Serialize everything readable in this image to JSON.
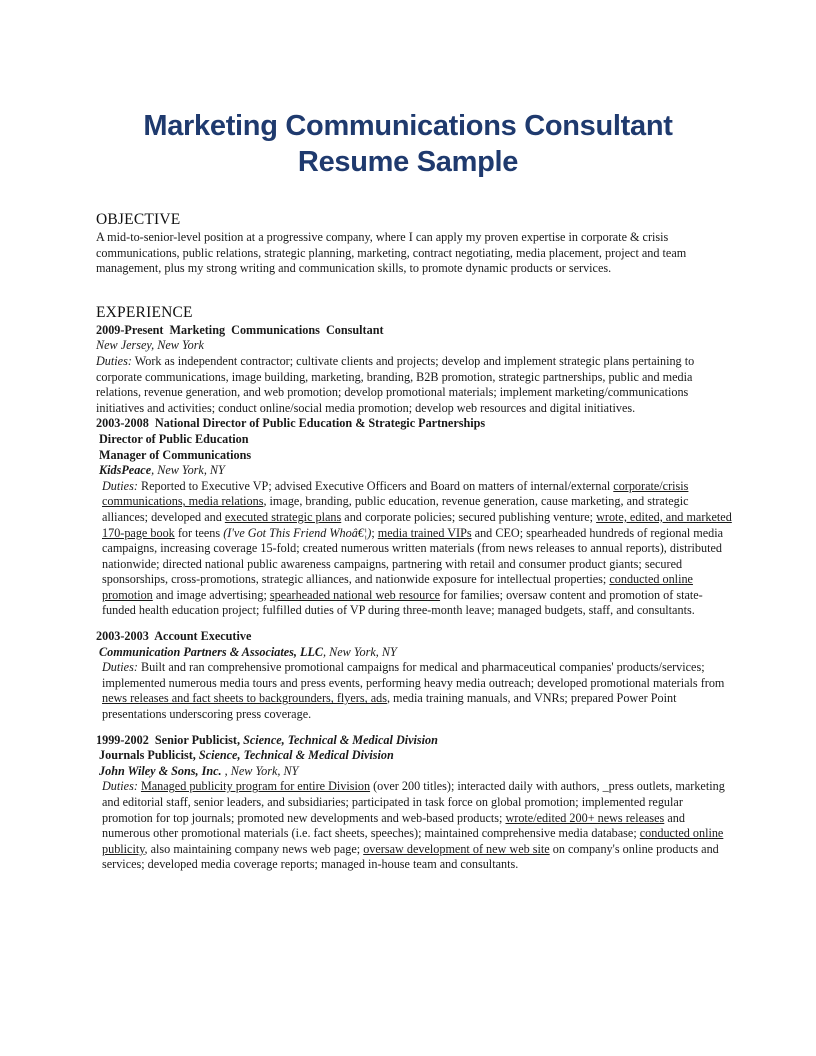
{
  "document": {
    "title_line1": "Marketing Communications Consultant",
    "title_line2": "Resume Sample",
    "title_color": "#1f3a6e"
  },
  "objective": {
    "heading": "OBJECTIVE",
    "text": "A mid-to-senior-level position at a progressive company, where I can apply my proven expertise in corporate & crisis communications, public relations, strategic planning, marketing, contract negotiating, media placement, project and team management, plus my strong writing and communication skills, to promote dynamic products or services."
  },
  "experience": {
    "heading": "EXPERIENCE",
    "jobs": [
      {
        "title_line": "2009-Present  Marketing  Communications  Consultant",
        "location": "New Jersey, New York",
        "duties_label": "Duties:",
        "duties": " Work as independent contractor; cultivate clients and projects; develop and implement strategic plans pertaining to corporate communications, image building, marketing, branding, B2B promotion, strategic partnerships, public and media relations, revenue generation, and web promotion; develop promotional materials; implement marketing/communications initiatives and activities; conduct online/social media promotion; develop web resources and digital initiatives."
      },
      {
        "title_line": "2003-2008  National Director of Public Education & Strategic Partnerships",
        "subtitle1": "Director of Public Education",
        "subtitle2": "Manager of Communications",
        "company": "KidsPeace",
        "location": ", New York, NY",
        "duties_label": "Duties:",
        "duties_parts": [
          " Reported to Executive VP; advised Executive Officers and Board on matters of internal/external ",
          "corporate/crisis communications, media relations",
          ", image, branding, public education, revenue generation, cause marketing, and strategic alliances; developed and ",
          "executed strategic plans",
          " and corporate policies; secured publishing venture; ",
          "wrote, edited, and marketed 170-page book",
          " for teens ",
          "(I've Got This Friend Whoâ€¦)",
          "; ",
          "media trained VIPs",
          "  and CEO; spearheaded hundreds of regional media campaigns, increasing coverage 15-fold; created numerous written materials (from news releases to annual reports), distributed nationwide; directed national public awareness campaigns, partnering with retail and consumer product giants; secured sponsorships, cross-promotions, strategic alliances, and nationwide exposure for intellectual properties; ",
          "conducted online promotion",
          " and image advertising; ",
          "spearheaded national web resource",
          " for families; oversaw content and promotion of state-funded health education project; fulfilled duties of VP during three-month leave; managed budgets, staff, and consultants."
        ]
      },
      {
        "title_line": "2003-2003  Account Executive",
        "company": "Communication Partners & Associates, LLC",
        "location": ", New York, NY",
        "duties_label": "Duties:",
        "duties_parts": [
          " Built and ran comprehensive promotional campaigns for medical and pharmaceutical companies' products/services; implemented numerous media tours and press events, performing heavy media outreach; developed promotional materials from ",
          "news releases and fact sheets to backgrounders, flyers, ads",
          ", media training manuals, and VNRs; prepared Power Point presentations underscoring press coverage."
        ]
      },
      {
        "title_prefix": "1999-2002  Senior Publicist, ",
        "title_division": "Science, Technical & Medical Division",
        "subtitle_prefix": "Journals Publicist, ",
        "subtitle_division": "Science, Technical & Medical Division",
        "company": "John Wiley & Sons, Inc.",
        "location": " , New York, NY",
        "duties_label": "Duties:",
        "duties_parts": [
          " ",
          "Managed publicity program for entire Division",
          " (over 200 titles); interacted daily with authors, _press outlets, marketing and editorial staff, senior leaders, and subsidiaries; participated in task force on global promotion; implemented regular promotion for top journals; promoted new developments and web-based products; ",
          "wrote/edited 200+ news releases",
          " and numerous other promotional materials (i.e. fact sheets, speeches); maintained comprehensive media database; ",
          "conducted online publicity",
          ", also maintaining company news web page; ",
          "oversaw development of new web site",
          " on company's online products and services; developed media coverage reports; managed in-house team and consultants."
        ]
      }
    ]
  }
}
